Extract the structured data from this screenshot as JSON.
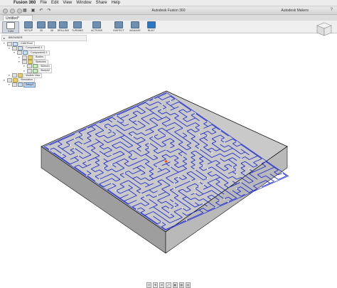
{
  "menubar": {
    "apple_glyph": "",
    "app_name": "Fusion 360",
    "items": [
      "File",
      "Edit",
      "View",
      "Window",
      "Share",
      "Help"
    ]
  },
  "window": {
    "title": "Autodesk Fusion 360",
    "user": "Autodesk Makers",
    "help_icon": "help-icon"
  },
  "doc_tab": {
    "label": "Untitled*"
  },
  "toolbar": {
    "workspace": "CAM",
    "tools": [
      "SETUP",
      "2D",
      "3D",
      "DRILLING",
      "TURNING",
      "ACTIONS",
      "INSPECT",
      "MANAGE",
      "BUILT"
    ]
  },
  "browser": {
    "header": "BROWSER",
    "nodes": [
      {
        "label": "CAM Root",
        "indent": 0,
        "icon": "comp"
      },
      {
        "label": "Component1:1",
        "indent": 1,
        "icon": "comp"
      },
      {
        "label": "Component1:1",
        "indent": 2,
        "icon": "comp"
      },
      {
        "label": "Bodies",
        "indent": 3,
        "icon": "folder"
      },
      {
        "label": "Sketches",
        "indent": 3,
        "icon": "folder"
      },
      {
        "label": "Sketch1",
        "indent": 4,
        "icon": "sketch"
      },
      {
        "label": "Sketch2",
        "indent": 4,
        "icon": "sketch"
      },
      {
        "label": "Models View",
        "indent": 1,
        "icon": "folder"
      },
      {
        "label": "Simulation",
        "indent": 0,
        "icon": "folder"
      },
      {
        "label": "Setup1",
        "indent": 1,
        "icon": "comp",
        "selected": true
      }
    ]
  },
  "colors": {
    "stock_top": "#c9c9c9",
    "stock_side_left": "#9e9e9e",
    "stock_side_right": "#b9b9b9",
    "maze_lines": "#1f2bd6",
    "edge": "#111111"
  }
}
